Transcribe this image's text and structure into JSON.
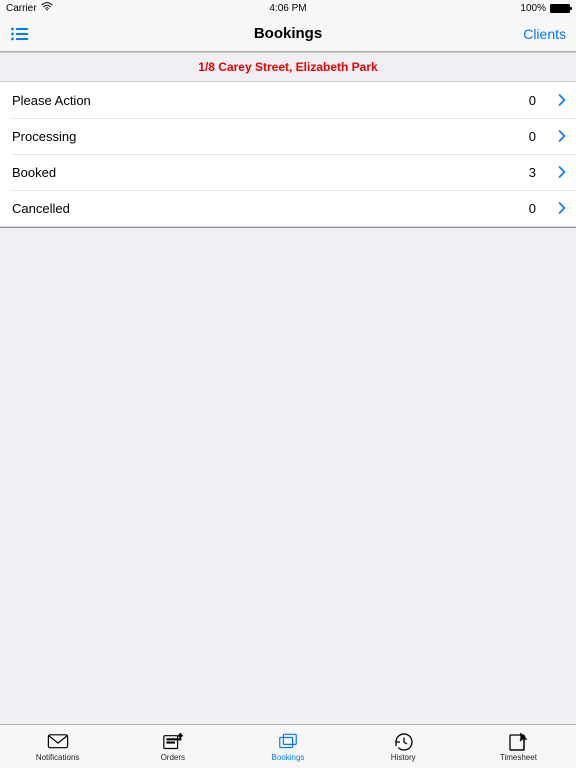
{
  "status": {
    "carrier": "Carrier",
    "time": "4:06 PM",
    "battery": "100%"
  },
  "nav": {
    "title": "Bookings",
    "right": "Clients"
  },
  "section": {
    "title": "1/8 Carey Street, Elizabeth Park"
  },
  "rows": [
    {
      "label": "Please Action",
      "count": "0"
    },
    {
      "label": "Processing",
      "count": "0"
    },
    {
      "label": "Booked",
      "count": "3"
    },
    {
      "label": "Cancelled",
      "count": "0"
    }
  ],
  "tabs": [
    {
      "label": "Notifications"
    },
    {
      "label": "Orders"
    },
    {
      "label": "Bookings"
    },
    {
      "label": "History"
    },
    {
      "label": "Timesheet"
    }
  ]
}
